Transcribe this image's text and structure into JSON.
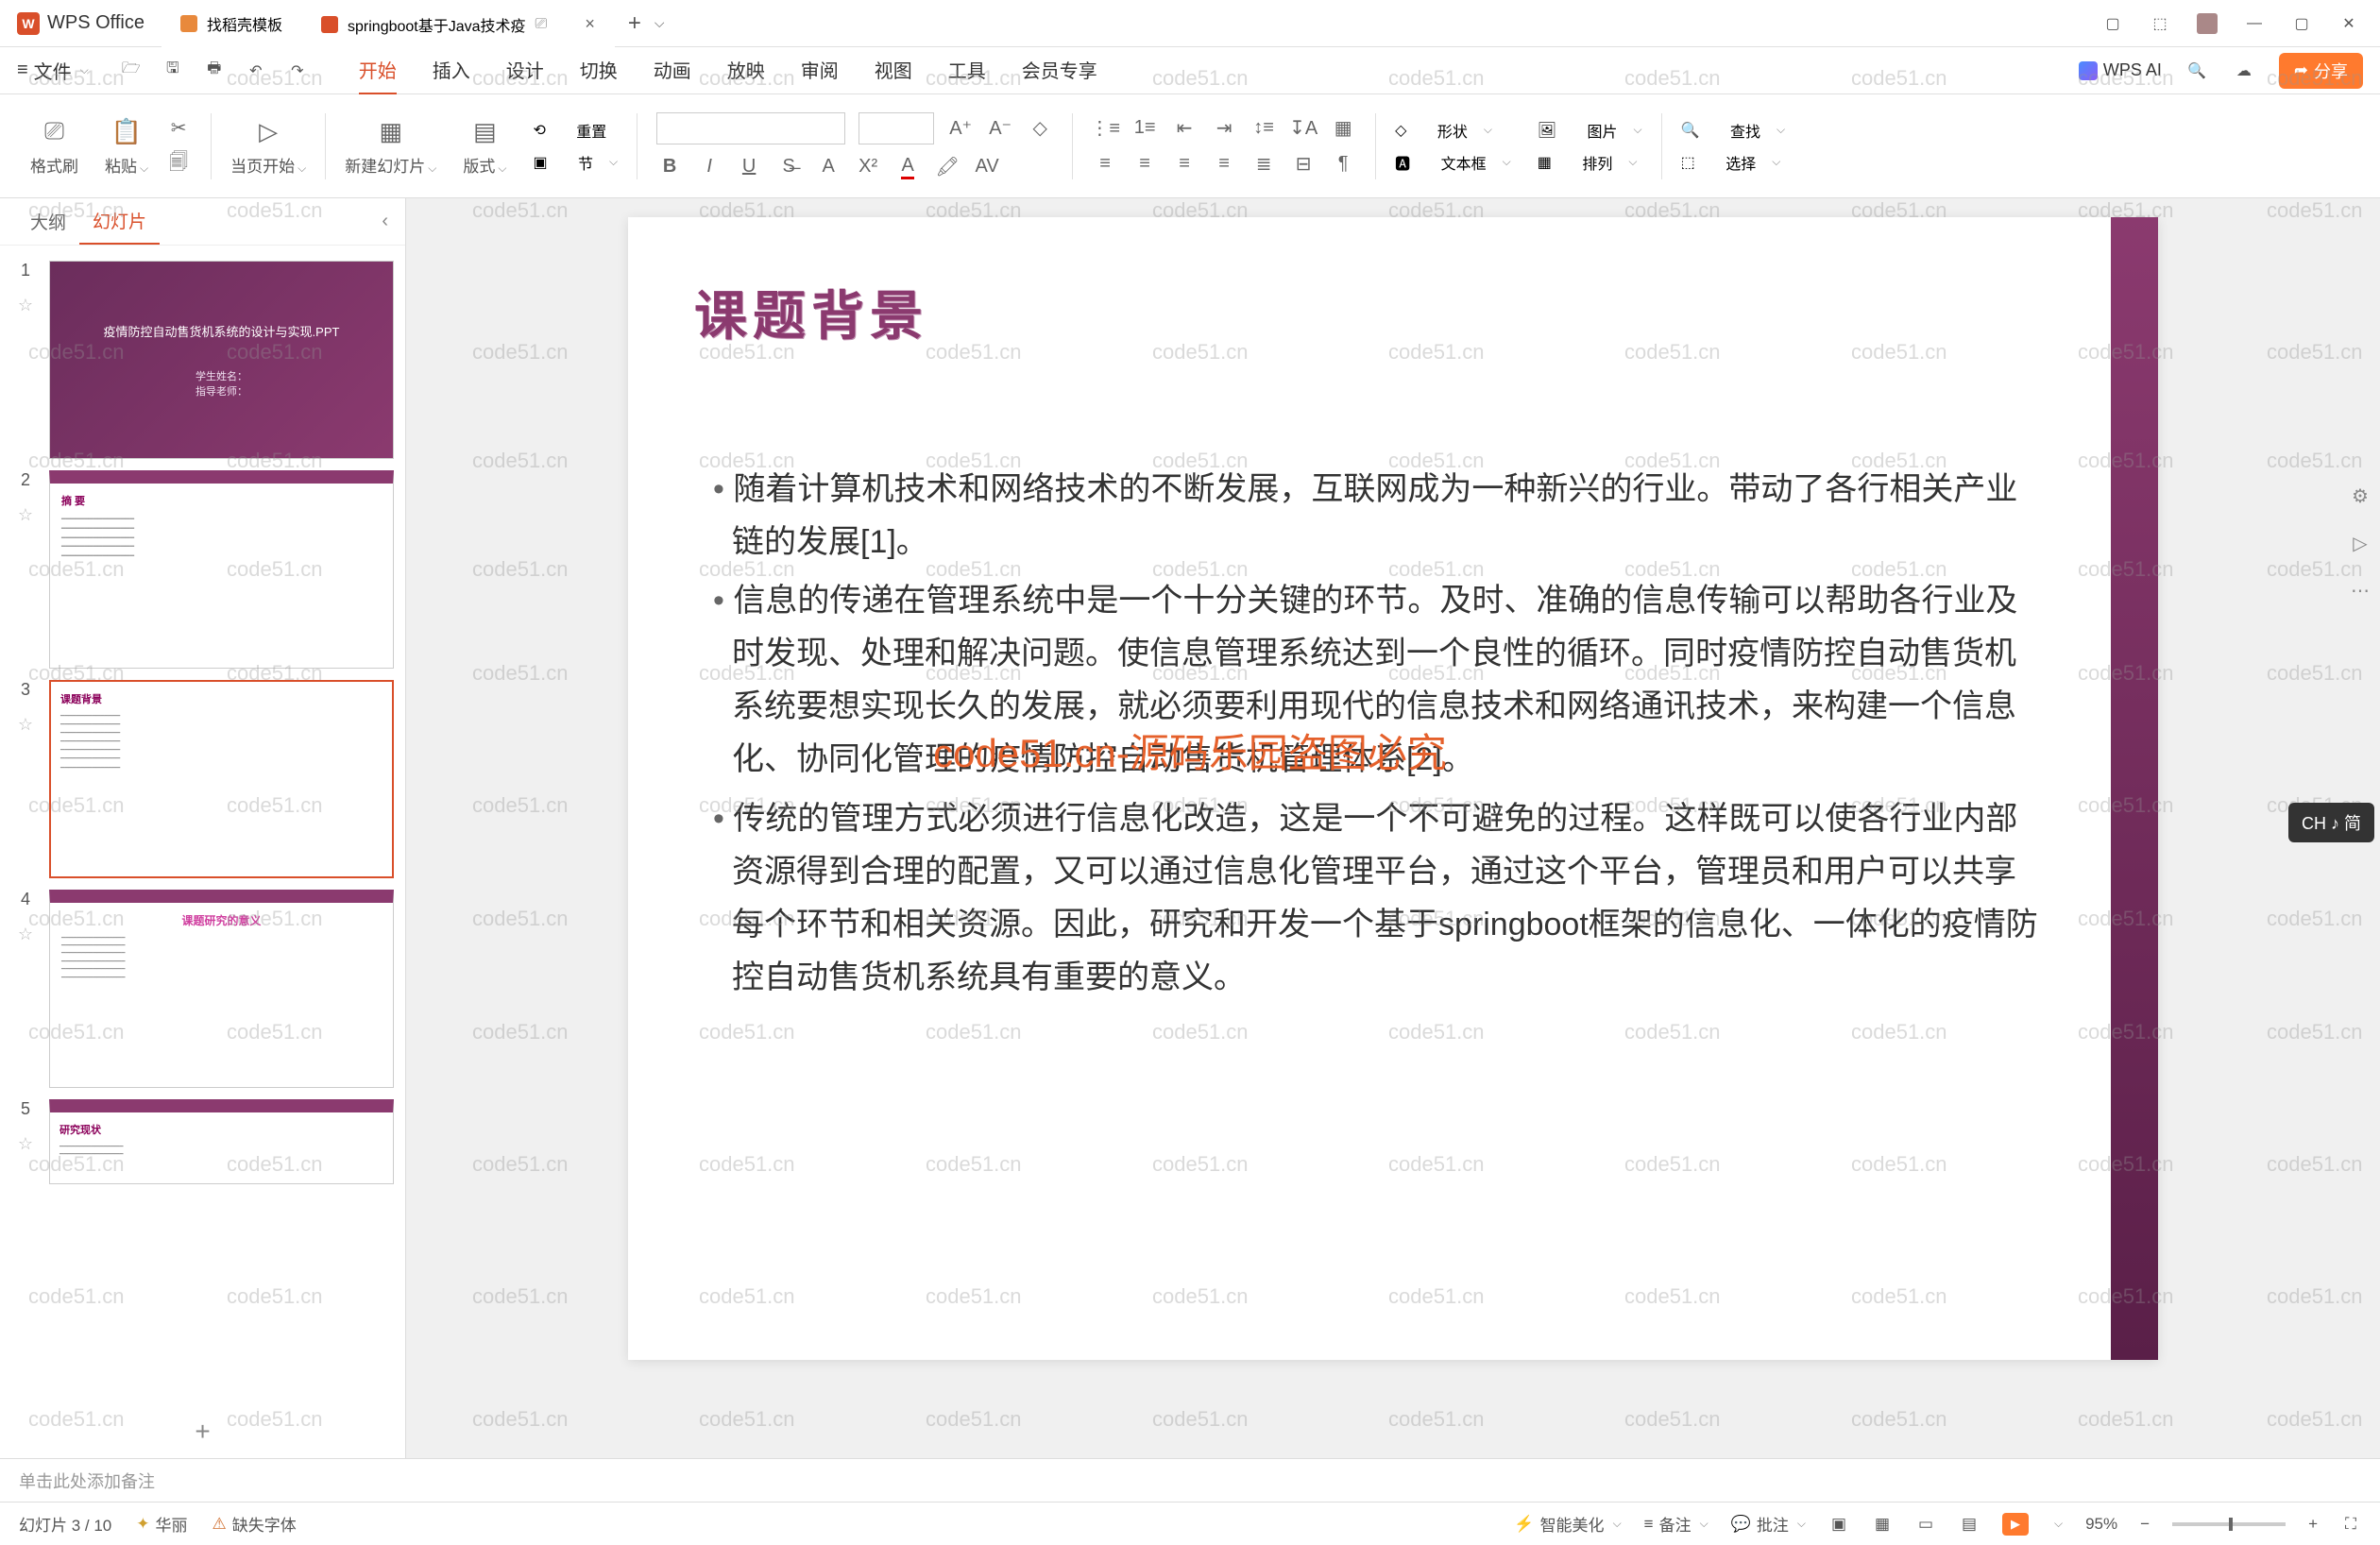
{
  "titlebar": {
    "app_name": "WPS Office",
    "tabs": [
      {
        "label": "找稻壳模板"
      },
      {
        "label": "springboot基于Java技术疫"
      }
    ]
  },
  "menubar": {
    "file": "文件",
    "tabs": [
      "开始",
      "插入",
      "设计",
      "切换",
      "动画",
      "放映",
      "审阅",
      "视图",
      "工具",
      "会员专享"
    ],
    "wps_ai": "WPS AI",
    "share": "分享"
  },
  "ribbon": {
    "format_brush": "格式刷",
    "paste": "粘贴",
    "from_current": "当页开始",
    "new_slide": "新建幻灯片",
    "layout": "版式",
    "section": "节",
    "reset": "重置",
    "shape": "形状",
    "picture": "图片",
    "textbox": "文本框",
    "arrange": "排列",
    "find": "查找",
    "select": "选择"
  },
  "sidebar": {
    "tab_outline": "大纲",
    "tab_slides": "幻灯片"
  },
  "thumbs": {
    "t1_title": "疫情防控自动售货机系统的设计与实现.PPT",
    "t1_sub1": "学生姓名：",
    "t1_sub2": "指导老师：",
    "t2_title": "摘 要",
    "t3_title": "课题背景",
    "t4_title": "课题研究的意义",
    "t5_title": "研究现状"
  },
  "slide": {
    "title": "课题背景",
    "p1": "随着计算机技术和网络技术的不断发展，互联网成为一种新兴的行业。带动了各行相关产业链的发展[1]。",
    "p2": "信息的传递在管理系统中是一个十分关键的环节。及时、准确的信息传输可以帮助各行业及时发现、处理和解决问题。使信息管理系统达到一个良性的循环。同时疫情防控自动售货机系统要想实现长久的发展，就必须要利用现代的信息技术和网络通讯技术，来构建一个信息化、协同化管理的疫情防控自动售货机管理体系[2]。",
    "p3": "传统的管理方式必须进行信息化改造，这是一个不可避免的过程。这样既可以使各行业内部资源得到合理的配置，又可以通过信息化管理平台，通过这个平台，管理员和用户可以共享每个环节和相关资源。因此，研究和开发一个基于springboot框架的信息化、一体化的疫情防控自动售货机系统具有重要的意义。"
  },
  "watermark": {
    "text": "code51.cn",
    "center": "code51.cn-源码乐园盗图必究"
  },
  "notes": {
    "placeholder": "单击此处添加备注"
  },
  "statusbar": {
    "slide_count": "幻灯片 3 / 10",
    "theme": "华丽",
    "missing_font": "缺失字体",
    "smart_beautify": "智能美化",
    "notes": "备注",
    "comments": "批注",
    "zoom": "95%"
  },
  "ime": {
    "text": "CH ♪ 简"
  }
}
